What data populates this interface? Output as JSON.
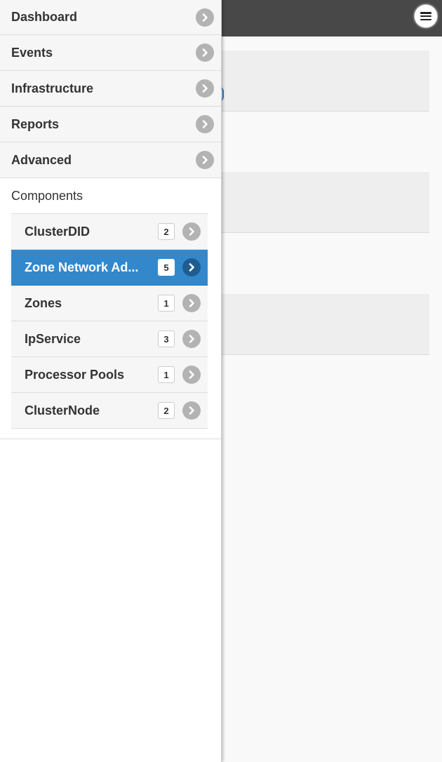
{
  "nav": {
    "items": [
      {
        "label": "Dashboard"
      },
      {
        "label": "Events"
      },
      {
        "label": "Infrastructure"
      },
      {
        "label": "Reports"
      },
      {
        "label": "Advanced"
      }
    ]
  },
  "components": {
    "title": "Components",
    "items": [
      {
        "label": "ClusterDID",
        "count": "2",
        "active": false
      },
      {
        "label": "Zone Network Ad...",
        "count": "5",
        "active": true
      },
      {
        "label": "Zones",
        "count": "1",
        "active": false
      },
      {
        "label": "IpService",
        "count": "3",
        "active": false
      },
      {
        "label": "Processor Pools",
        "count": "1",
        "active": false
      },
      {
        "label": "ClusterNode",
        "count": "2",
        "active": false
      }
    ]
  },
  "icons": {
    "menu": "hamburger-menu-icon",
    "chevron": "chevron-right-icon"
  },
  "colors": {
    "header": "#484848",
    "active_item": "#3388cc",
    "chevron_bg": "#b3b3b3",
    "active_chevron_bg": "#1f5d91"
  }
}
